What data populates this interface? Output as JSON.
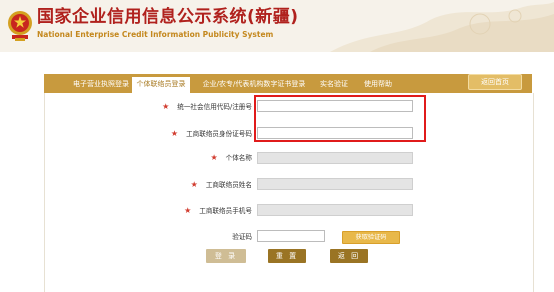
{
  "header": {
    "title": "国家企业信用信息公示系统(新疆)",
    "subtitle": "National Enterprise Credit Information Publicity System",
    "emblem_icon": "national-emblem-icon"
  },
  "nav": {
    "tabs": [
      "电子营业执照登录",
      "个体联络员登录",
      "企业/农专/代表机构数字证书登录",
      "实名验证",
      "使用帮助"
    ],
    "active_index": 1,
    "home_button": "返回首页"
  },
  "form": {
    "fields": [
      {
        "label": "统一社会信用代码/注册号",
        "required": true,
        "value": "",
        "disabled": false
      },
      {
        "label": "工商联络员身份证号码",
        "required": true,
        "value": "",
        "disabled": false
      },
      {
        "label": "个体名称",
        "required": true,
        "value": "",
        "disabled": true
      },
      {
        "label": "工商联络员姓名",
        "required": true,
        "value": "",
        "disabled": true
      },
      {
        "label": "工商联络员手机号",
        "required": true,
        "value": "",
        "disabled": true
      }
    ],
    "captcha_label": "验证码",
    "captcha_value": "",
    "get_code_button": "获取验证码",
    "buttons": {
      "login": "登 录",
      "reset": "重 置",
      "back": "返 回"
    }
  },
  "colors": {
    "brand_red": "#b0211d",
    "nav_gold": "#c89a3e",
    "button_brown": "#9a7424",
    "highlight_red": "#e01b1b",
    "required_star": "#d13b2e"
  }
}
